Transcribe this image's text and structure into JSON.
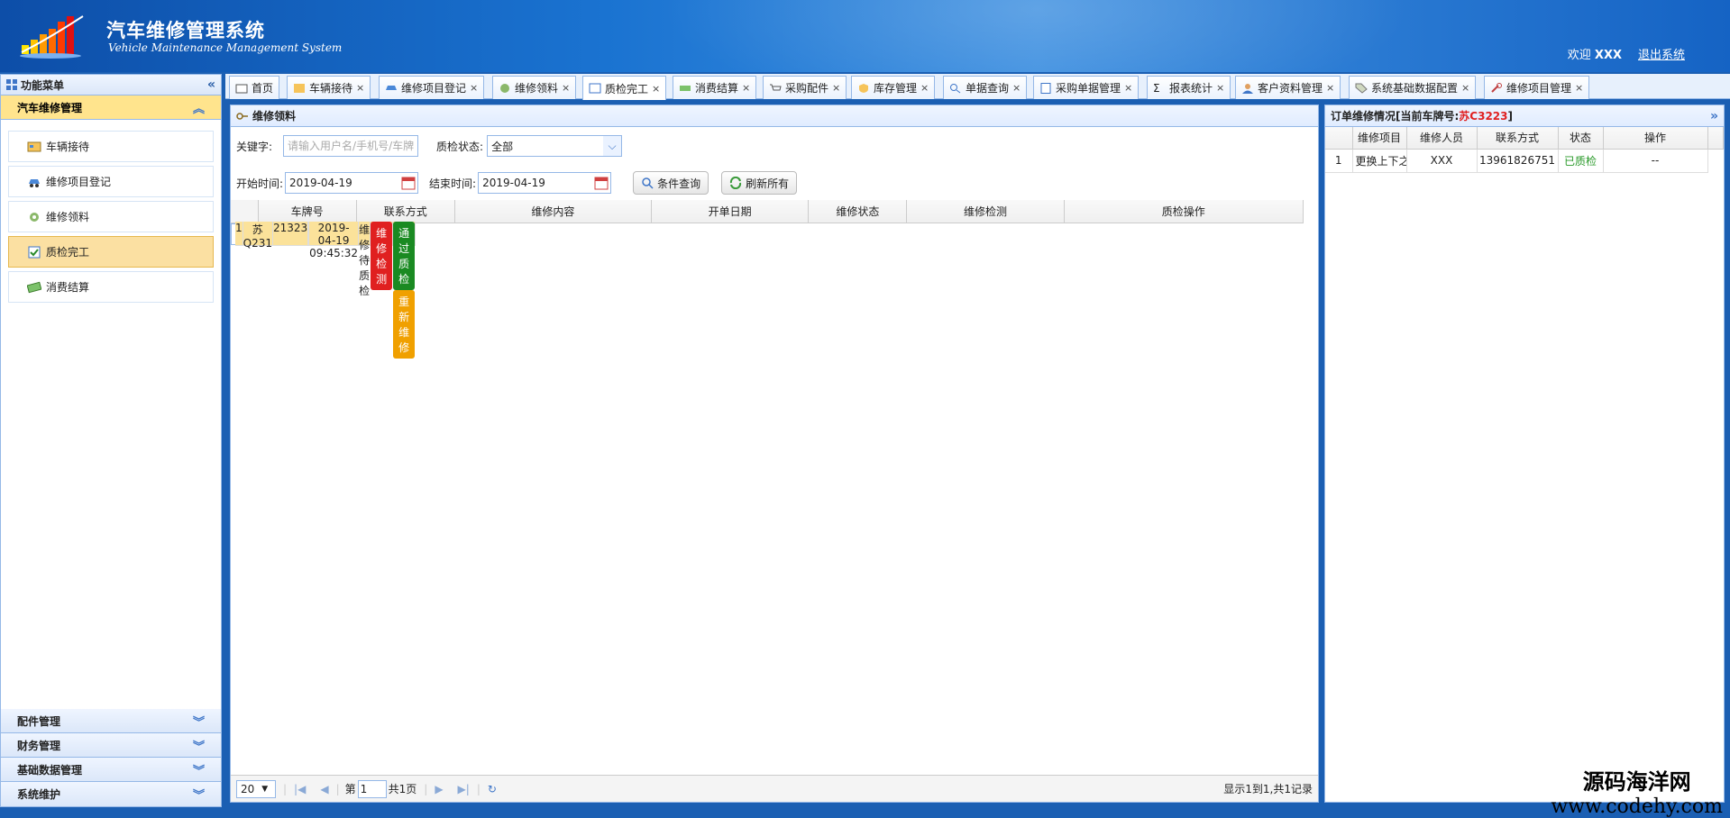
{
  "header": {
    "title": "汽车维修管理系统",
    "subtitle": "Vehicle Maintenance Management System",
    "welcome_prefix": "欢迎",
    "user": "XXX",
    "logout": "退出系统"
  },
  "left": {
    "title": "功能菜单",
    "active_group": "汽车维修管理",
    "items": [
      {
        "label": "车辆接待",
        "icon": "car-reception-icon"
      },
      {
        "label": "维修项目登记",
        "icon": "car-icon"
      },
      {
        "label": "维修领料",
        "icon": "parts-icon"
      },
      {
        "label": "质检完工",
        "icon": "inspection-icon"
      },
      {
        "label": "消费结算",
        "icon": "money-icon"
      }
    ],
    "groups": [
      "配件管理",
      "财务管理",
      "基础数据管理",
      "系统维护"
    ]
  },
  "tabs": [
    {
      "label": "首页"
    },
    {
      "label": "车辆接待"
    },
    {
      "label": "维修项目登记"
    },
    {
      "label": "维修领料"
    },
    {
      "label": "质检完工"
    },
    {
      "label": "消费结算"
    },
    {
      "label": "采购配件"
    },
    {
      "label": "库存管理"
    },
    {
      "label": "单据查询"
    },
    {
      "label": "采购单据管理"
    },
    {
      "label": "报表统计"
    },
    {
      "label": "客户资料管理"
    },
    {
      "label": "系统基础数据配置"
    },
    {
      "label": "维修项目管理"
    }
  ],
  "center": {
    "title": "维修领料",
    "keyword_label": "关键字:",
    "keyword_placeholder": "请输入用户名/手机号/车牌",
    "qc_status_label": "质检状态:",
    "qc_status_value": "全部",
    "start_label": "开始时间:",
    "start_value": "2019-04-19",
    "end_label": "结束时间:",
    "end_value": "2019-04-19",
    "query_btn": "条件查询",
    "refresh_btn": "刷新所有",
    "columns": [
      "车牌号",
      "联系方式",
      "维修内容",
      "开单日期",
      "维修状态",
      "维修检测",
      "质检操作"
    ],
    "rows": [
      {
        "no": "1",
        "plate": "苏Q231",
        "contact": "21323",
        "content": "",
        "date": "2019-04-19 09:45:32",
        "status": "维修待质检",
        "check_btn": "维修检测",
        "pass_btn": "通过质检",
        "redo_btn": "重新维修"
      }
    ],
    "pager": {
      "page_size": "20",
      "page_prefix": "第",
      "page": "1",
      "page_suffix": "共1页",
      "info": "显示1到1,共1记录"
    }
  },
  "right": {
    "title_prefix": "订单维修情况[当前车牌号:",
    "plate": "苏C3223",
    "title_suffix": "]",
    "columns": [
      "维修项目",
      "维修人员",
      "联系方式",
      "状态",
      "操作"
    ],
    "rows": [
      {
        "no": "1",
        "item": "更换上下之",
        "worker": "XXX",
        "phone": "13961826751",
        "status": "已质检",
        "op": "--"
      }
    ]
  },
  "watermark": {
    "line1": "源码海洋网",
    "line2": "www.codehy.com"
  },
  "colors": {
    "accent": "#1a73d1",
    "selected_row": "#fbe29a",
    "danger": "#e02020",
    "success": "#1a8a22",
    "warning": "#f0a000",
    "border": "#95b8e7"
  }
}
